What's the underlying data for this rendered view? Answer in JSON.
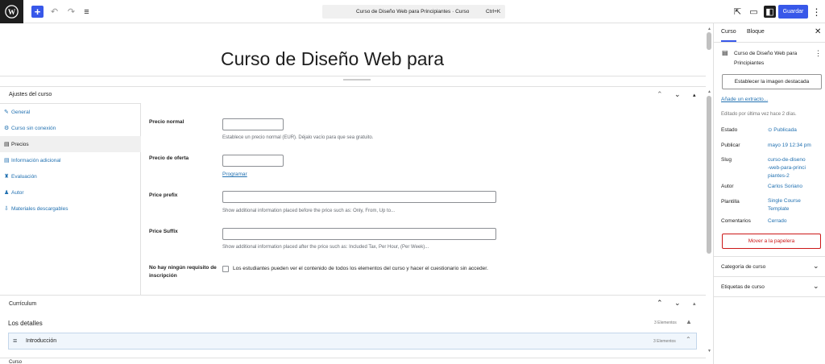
{
  "toolbar": {
    "command_text": "Curso de Diseño Web para Principiantes · Curso",
    "command_shortcut": "Ctrl+K",
    "save_label": "Guardar"
  },
  "editor": {
    "title": "Curso de Diseño Web para"
  },
  "metabox": {
    "heading": "Ajustes del curso",
    "tabs": [
      {
        "label": "General",
        "icon": "wrench-icon"
      },
      {
        "label": "Curso sin conexión",
        "icon": "plugin-icon"
      },
      {
        "label": "Precios",
        "icon": "cart-icon"
      },
      {
        "label": "Información adicional",
        "icon": "list-icon"
      },
      {
        "label": "Evaluación",
        "icon": "award-icon"
      },
      {
        "label": "Autor",
        "icon": "user-icon"
      },
      {
        "label": "Materiales descargables",
        "icon": "download-icon"
      }
    ],
    "fields": {
      "precio_normal_label": "Precio normal",
      "precio_normal_desc": "Establece un precio normal (EUR). Déjalo vacío para que sea gratuito.",
      "precio_oferta_label": "Precio de oferta",
      "programar_link": "Programar",
      "price_prefix_label": "Price prefix",
      "price_prefix_desc": "Show additional information placed before the price such as: Only, From, Up to...",
      "price_suffix_label": "Price Suffix",
      "price_suffix_desc": "Show additional information placed after the price such as: Included Tax, Per Hour, (Per Week)...",
      "no_req_label_1": "No hay ningún requisito de",
      "no_req_label_2": "inscripción",
      "no_req_desc": "Los estudiantes pueden ver el contenido de todos los elementos del curso y hacer el cuestionario sin acceder."
    }
  },
  "curriculum": {
    "heading": "Currículum",
    "details_title": "Los detalles",
    "details_count": "3 Elementos",
    "section_name": "Introducción",
    "section_count": "3 Elementos",
    "footer_label": "Curso"
  },
  "sidebar": {
    "tab_post": "Curso",
    "tab_block": "Bloque",
    "doc_title": "Curso de Diseño Web para Principiantes",
    "featured_image": "Establecer la imagen destacada",
    "excerpt_link": "Añade un extracto...",
    "last_edited": "Editado por última vez hace 2 días.",
    "rows": {
      "estado_k": "Estado",
      "estado_v": "Publicada",
      "publicar_k": "Publicar",
      "publicar_v": "mayo 19 12:34 pm",
      "slug_k": "Slug",
      "slug_v": "curso-de-diseno-web-para-principiantes-2",
      "autor_k": "Autor",
      "autor_v": "Carlos Soriano",
      "plantilla_k": "Plantilla",
      "plantilla_v": "Single Course Template",
      "comentarios_k": "Comentarios",
      "comentarios_v": "Cerrado"
    },
    "trash": "Mover a la papelera",
    "panel_category": "Categoría de curso",
    "panel_tags": "Etiquetas de curso"
  }
}
